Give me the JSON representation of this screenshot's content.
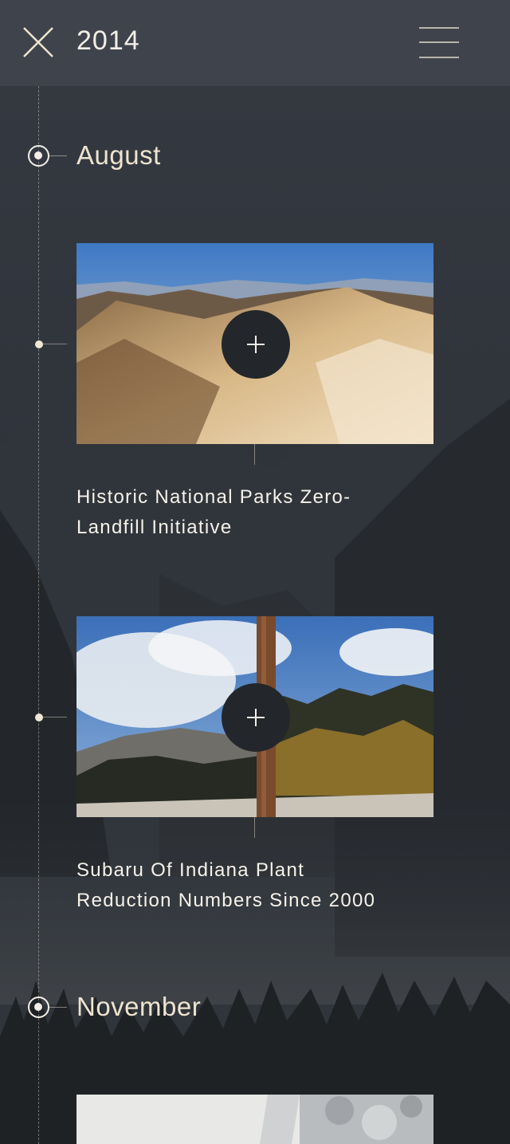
{
  "header": {
    "year": "2014",
    "close_icon": "close-icon",
    "menu_icon": "hamburger-menu-icon"
  },
  "timeline": {
    "months": [
      {
        "label": "August"
      },
      {
        "label": "November"
      }
    ],
    "entries": [
      {
        "title_line1": "Historic National Parks Zero-",
        "title_line2": "Landfill Initiative",
        "expand_icon": "plus-icon"
      },
      {
        "title_line1": "Subaru Of Indiana Plant",
        "title_line2": "Reduction Numbers Since 2000",
        "expand_icon": "plus-icon"
      }
    ]
  },
  "colors": {
    "header_bg": "#3f444c",
    "page_bg": "#2c3138",
    "accent_text": "#eee3cf",
    "button_bg": "#23262a"
  }
}
